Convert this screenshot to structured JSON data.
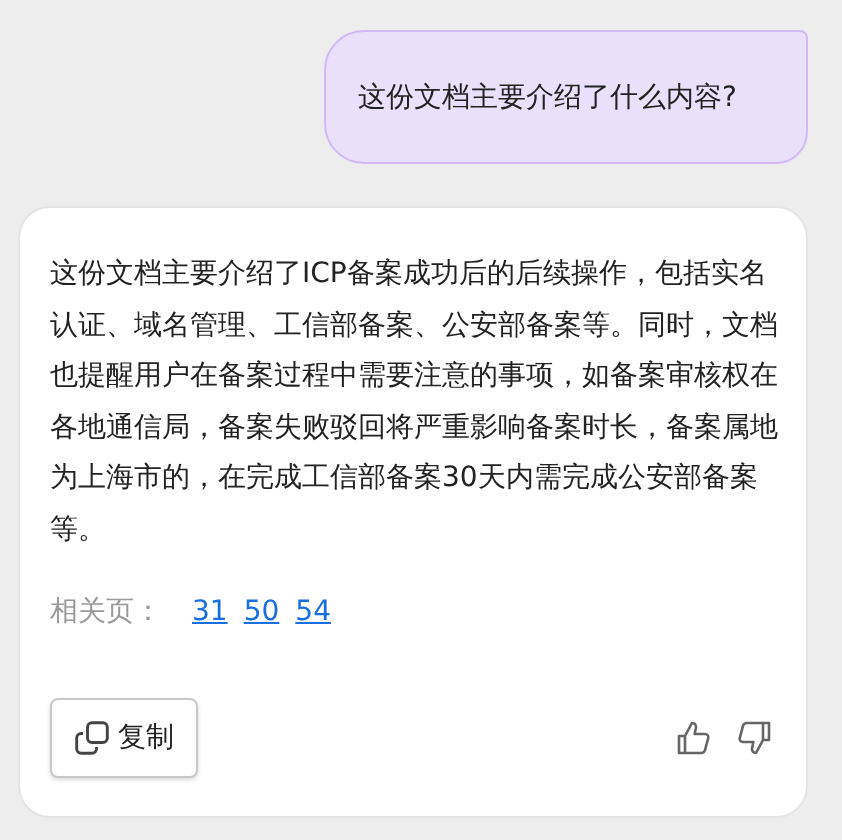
{
  "question": "这份文档主要介绍了什么内容?",
  "answer": {
    "text": "这份文档主要介绍了ICP备案成功后的后续操作，包括实名认证、域名管理、工信部备案、公安部备案等。同时，文档也提醒用户在备案过程中需要注意的事项，如备案审核权在各地通信局，备案失败驳回将严重影响备案时长，备案属地为上海市的，在完成工信部备案30天内需完成公安部备案等。",
    "related_label": "相关页：",
    "related_pages": [
      "31",
      "50",
      "54"
    ],
    "copy_button": "复制"
  }
}
